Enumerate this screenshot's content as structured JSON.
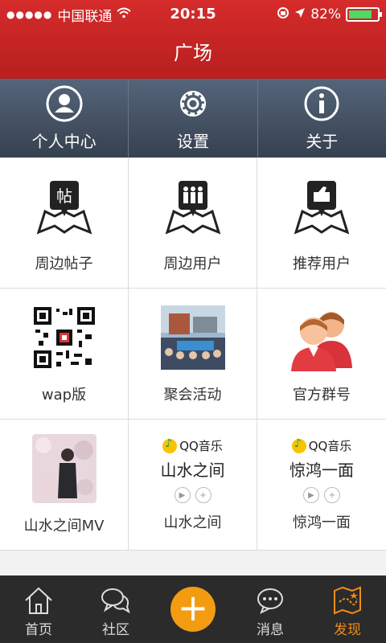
{
  "status": {
    "carrier": "中国联通",
    "time": "20:15",
    "battery": "82%"
  },
  "header": {
    "title": "广场"
  },
  "quick_menu": [
    {
      "label": "个人中心",
      "icon": "user-icon"
    },
    {
      "label": "设置",
      "icon": "gear-icon"
    },
    {
      "label": "关于",
      "icon": "info-icon"
    }
  ],
  "grid": [
    {
      "label": "周边帖子",
      "icon": "post-map-icon"
    },
    {
      "label": "周边用户",
      "icon": "users-map-icon"
    },
    {
      "label": "推荐用户",
      "icon": "thumb-map-icon"
    },
    {
      "label": "wap版",
      "icon": "qr-code-image"
    },
    {
      "label": "聚会活动",
      "icon": "event-photo"
    },
    {
      "label": "官方群号",
      "icon": "group-avatar-icon"
    },
    {
      "label": "山水之间MV",
      "icon": "mv-photo"
    },
    {
      "label": "山水之间",
      "brand": "QQ音乐",
      "song": "山水之间"
    },
    {
      "label": "惊鸿一面",
      "brand": "QQ音乐",
      "song": "惊鸿一面"
    }
  ],
  "tabs": [
    {
      "label": "首页",
      "icon": "home-icon"
    },
    {
      "label": "社区",
      "icon": "chat-bubbles-icon"
    },
    {
      "label": "+",
      "icon": "plus-icon"
    },
    {
      "label": "消息",
      "icon": "message-icon"
    },
    {
      "label": "发现",
      "icon": "discover-map-icon",
      "active": true
    }
  ],
  "colors": {
    "header": "#c62222",
    "accent": "#f39c12",
    "tabbar": "#2b2b2b"
  }
}
